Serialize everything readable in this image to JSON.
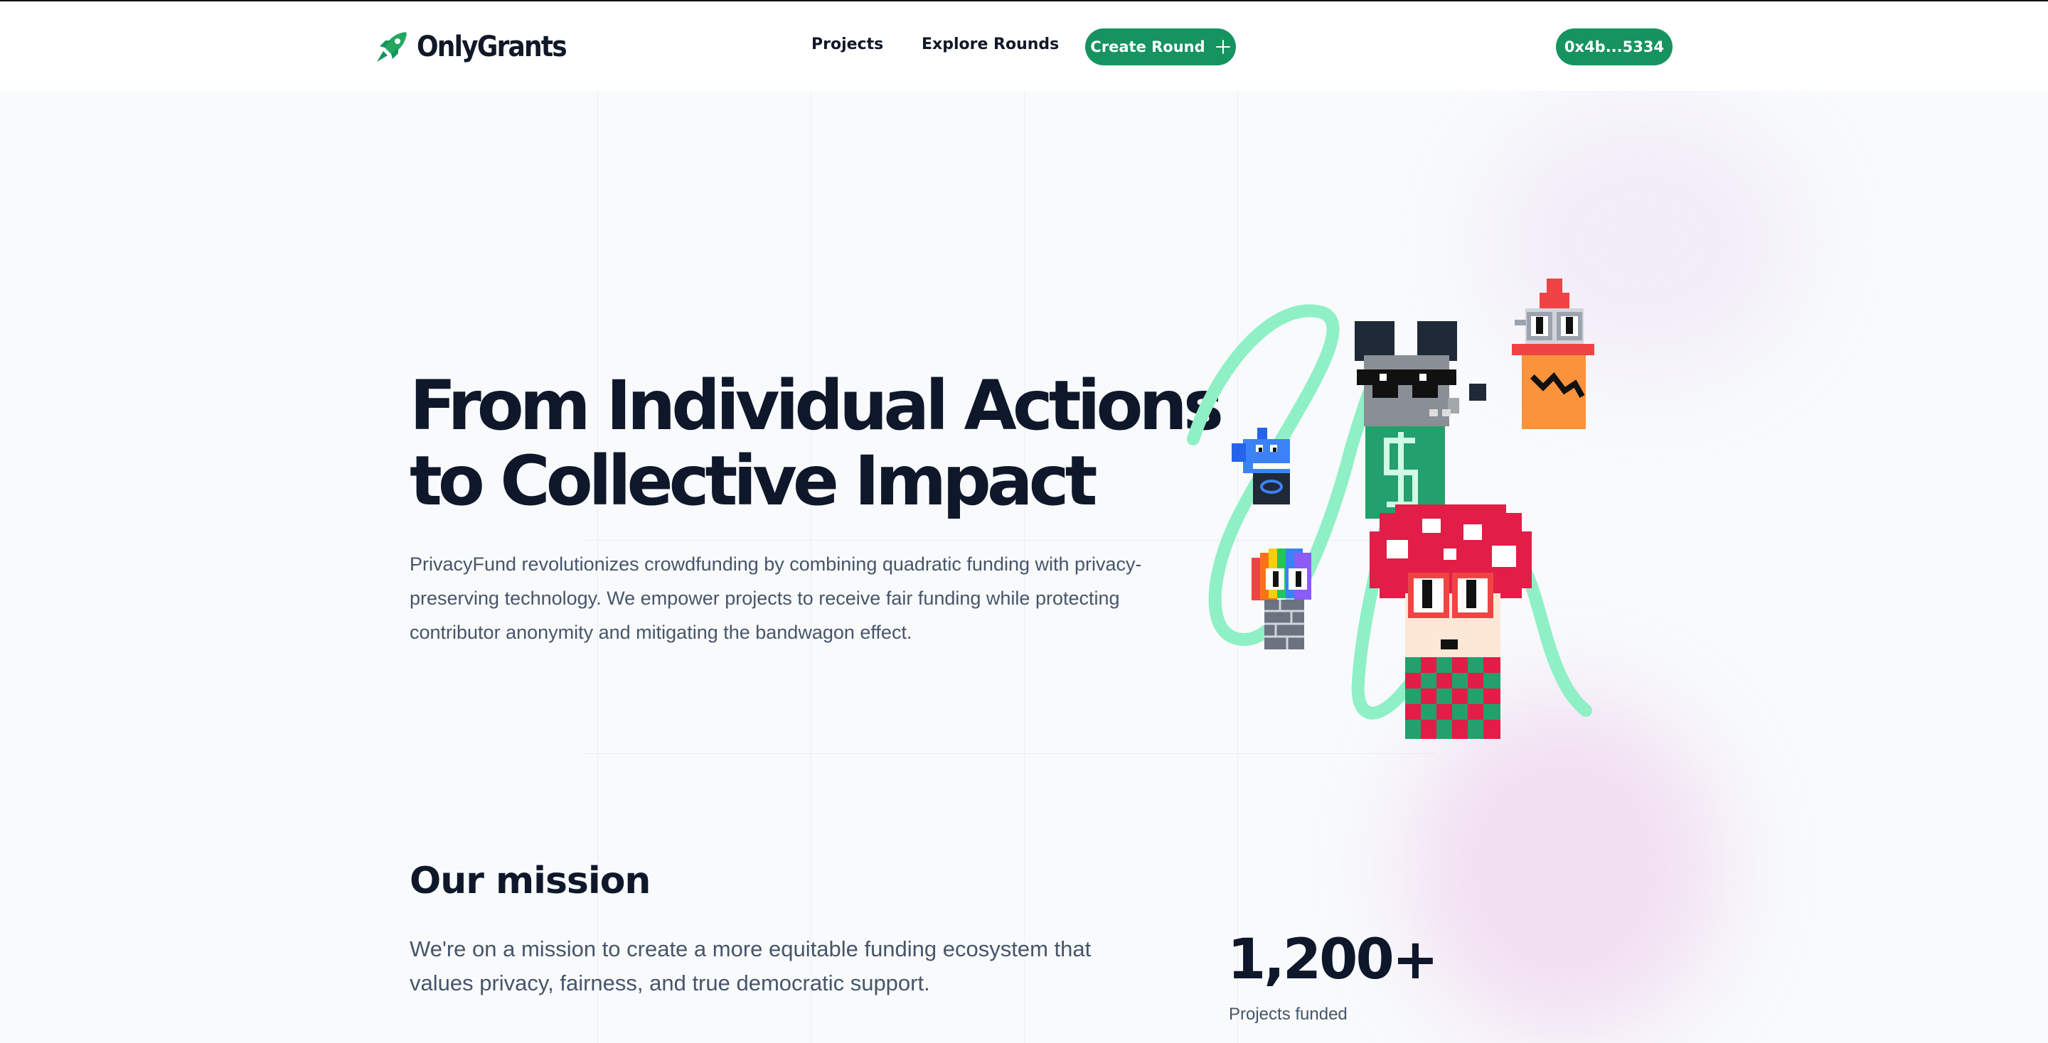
{
  "header": {
    "logo_text": "OnlyGrants",
    "nav": {
      "projects": "Projects",
      "explore_rounds": "Explore Rounds"
    },
    "create_round": "Create Round",
    "wallet": "0x4b...5334"
  },
  "hero": {
    "title_line1": "From Individual Actions",
    "title_line2": "to Collective Impact",
    "description": "PrivacyFund revolutionizes crowdfunding by combining quadratic funding with privacy-preserving technology. We empower projects to receive fair funding while protecting contributor anonymity and mitigating the bandwagon effect.",
    "illustration_icons": [
      "mouse-character-icon",
      "shark-character-icon",
      "candle-character-icon",
      "rainbow-character-icon",
      "mushroom-character-icon"
    ]
  },
  "mission": {
    "title": "Our mission",
    "description": "We're on a mission to create a more equitable funding ecosystem that values privacy, fairness, and true democratic support.",
    "stat_value": "1,200+",
    "stat_label": "Projects funded"
  },
  "colors": {
    "brand_green": "#16935f",
    "squiggle": "#8ff0c5",
    "text_dark": "#0f172a",
    "text_muted": "#475569"
  }
}
